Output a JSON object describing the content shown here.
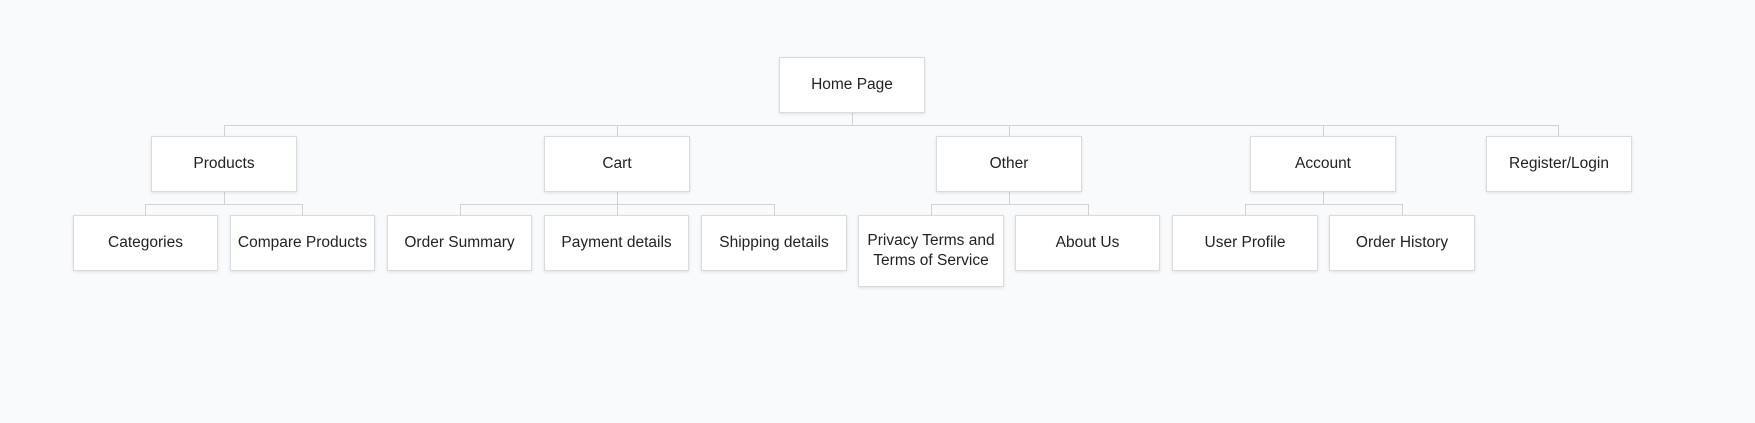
{
  "sitemap": {
    "root": "Home Page",
    "sections": {
      "products": {
        "label": "Products",
        "children": [
          "Categories",
          "Compare Products"
        ]
      },
      "cart": {
        "label": "Cart",
        "children": [
          "Order Summary",
          "Payment details",
          "Shipping details"
        ]
      },
      "other": {
        "label": "Other",
        "children": [
          "Privacy Terms and Terms of Service",
          "About Us"
        ]
      },
      "account": {
        "label": "Account",
        "children": [
          "User Profile",
          "Order History"
        ]
      },
      "register": {
        "label": "Register/Login"
      }
    }
  }
}
